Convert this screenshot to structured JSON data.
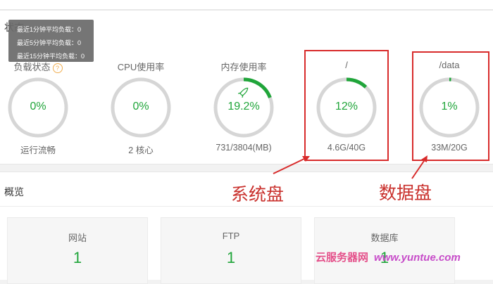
{
  "status": {
    "title": "状态",
    "tooltip": [
      "最近1分钟平均负载：0",
      "最近5分钟平均负载：0",
      "最近15分钟平均负载：0"
    ],
    "gauges": [
      {
        "title": "负载状态",
        "value": "0%",
        "foot": "运行流畅",
        "percent": 0
      },
      {
        "title": "CPU使用率",
        "value": "0%",
        "foot": "2 核心",
        "percent": 0
      },
      {
        "title": "内存使用率",
        "value": "19.2%",
        "foot": "731/3804(MB)",
        "percent": 19.2
      },
      {
        "title": "/",
        "value": "12%",
        "foot": "4.6G/40G",
        "percent": 12
      },
      {
        "title": "/data",
        "value": "1%",
        "foot": "33M/20G",
        "percent": 1
      }
    ]
  },
  "annotations": {
    "system_disk": "系统盘",
    "data_disk": "数据盘"
  },
  "overview": {
    "title": "概览",
    "cards": [
      {
        "label": "网站",
        "value": "1"
      },
      {
        "label": "FTP",
        "value": "1"
      },
      {
        "label": "数据库",
        "value": "1"
      }
    ]
  },
  "watermark": {
    "cn": "云服务器网",
    "url": "www.yuntue.com"
  },
  "colors": {
    "accent_green": "#20a53a",
    "ring_gray": "#d6d6d6",
    "annotation_red": "#d82b2b"
  },
  "icons": {
    "help": "question-circle-icon",
    "memory": "rocket-icon"
  }
}
